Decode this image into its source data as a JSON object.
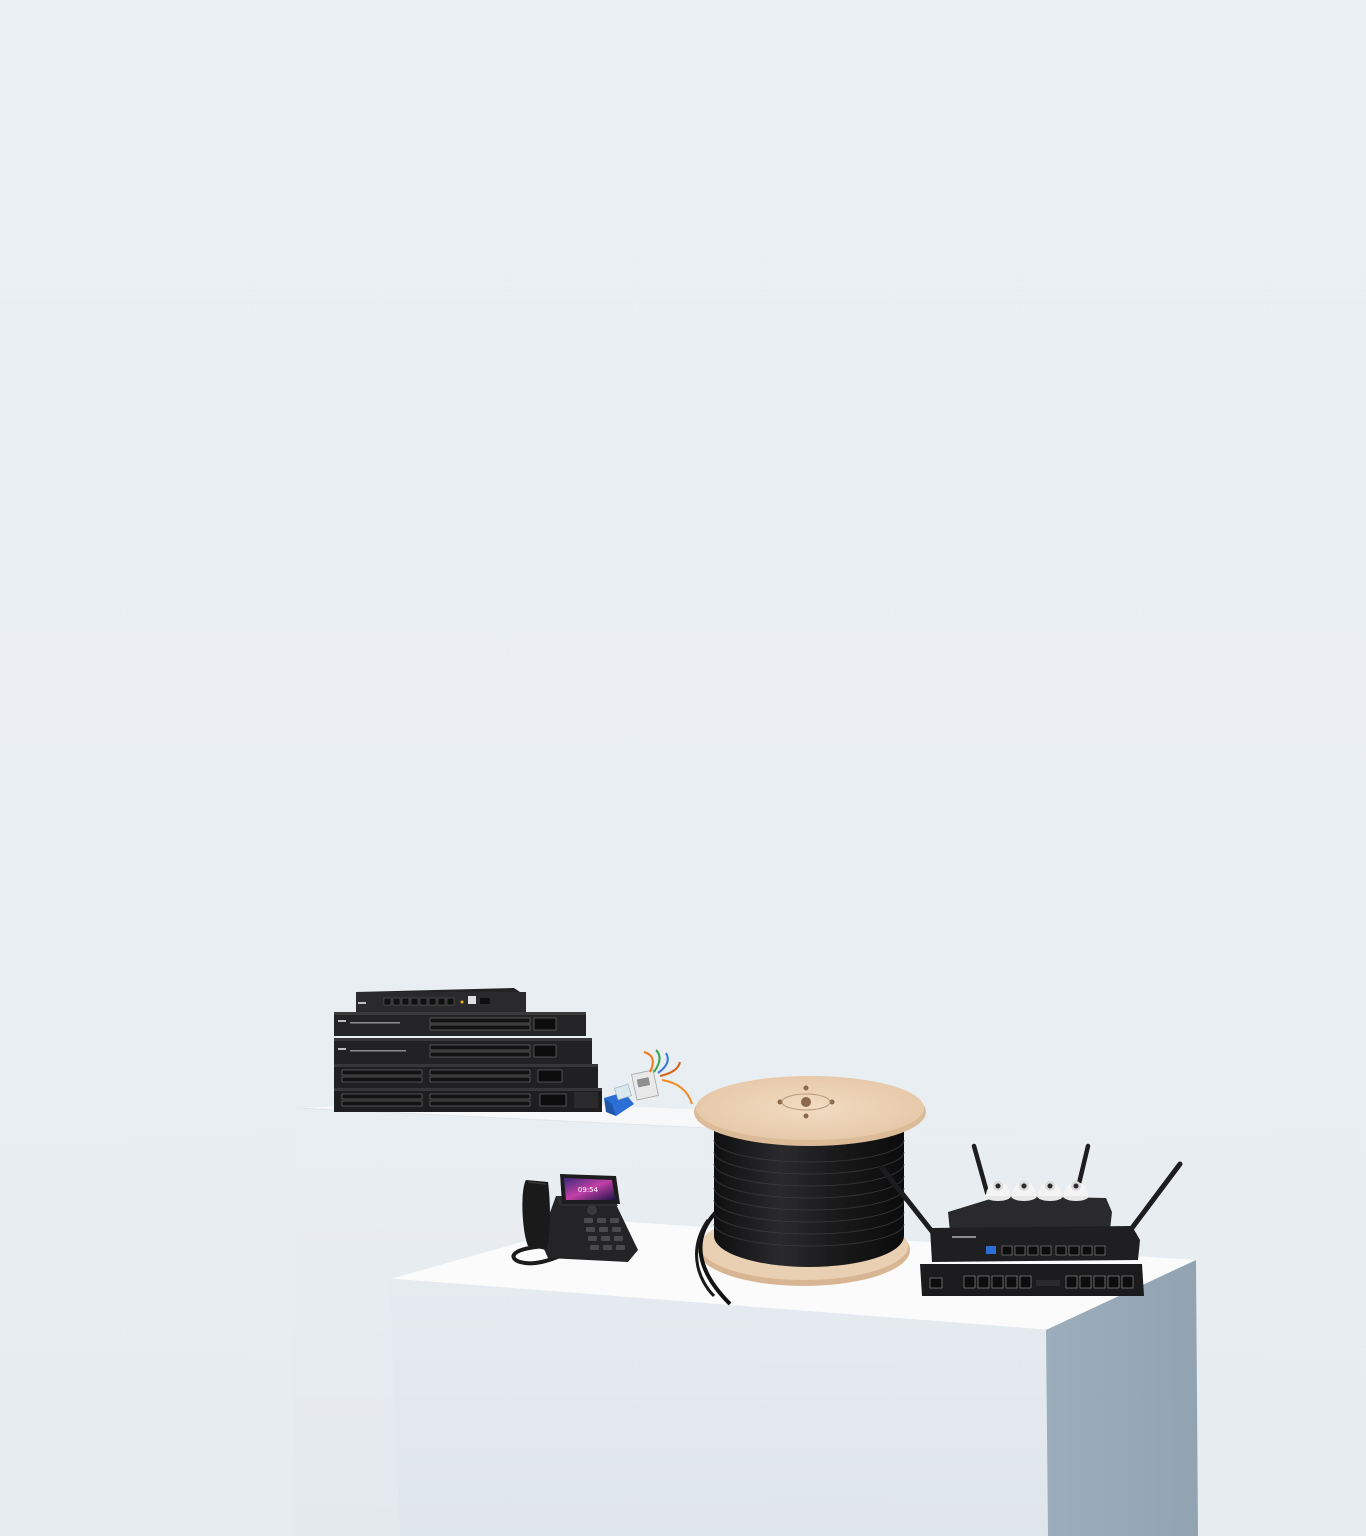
{
  "scene": {
    "background_color": "#eaeff3",
    "items": [
      {
        "name": "network-switch-stack"
      },
      {
        "name": "rj45-connectors"
      },
      {
        "name": "ip-desk-phone",
        "screen_time": "09:54"
      },
      {
        "name": "cable-reel"
      },
      {
        "name": "dome-security-cameras",
        "count": 4
      },
      {
        "name": "wireless-router"
      }
    ],
    "colors": {
      "podium_top": "#fbfbfb",
      "podium_front": "#e3e9ef",
      "podium_side": "#99aab8",
      "device_black": "#1f1f21",
      "reel_wood": "#ecd2b5",
      "connector_blue": "#2b6fd6"
    }
  }
}
